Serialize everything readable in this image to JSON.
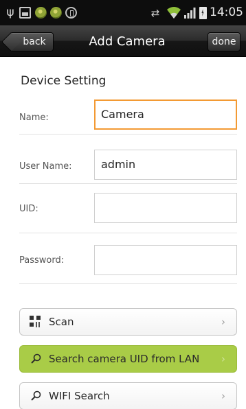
{
  "status_bar": {
    "time": "14:05",
    "icons": [
      "usb-icon",
      "image-icon",
      "app-icon",
      "app-icon",
      "circle-icon",
      "sync-icon",
      "wifi-icon",
      "signal-icon",
      "battery-icon"
    ]
  },
  "nav": {
    "back_label": "back",
    "title": "Add Camera",
    "done_label": "done"
  },
  "form": {
    "section_title": "Device Setting",
    "name_label": "Name:",
    "name_value": "Camera",
    "username_label": "User Name:",
    "username_value": "admin",
    "uid_label": "UID:",
    "uid_value": "",
    "password_label": "Password:",
    "password_value": ""
  },
  "actions": {
    "scan_label": "Scan",
    "lan_label": "Search camera UID from LAN",
    "wifi_label": "WIFI Search",
    "chevron": "›"
  },
  "colors": {
    "highlight": "#a9cc47",
    "focus_border": "#f39a33"
  }
}
